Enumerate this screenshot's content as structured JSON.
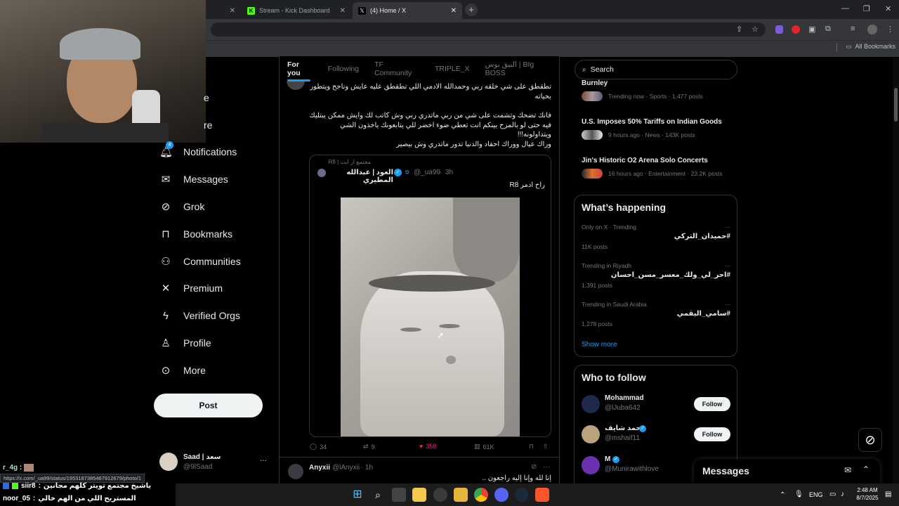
{
  "browser": {
    "tabs": [
      {
        "label": "Stream - Kick Dashboard"
      },
      {
        "label": "(4) Home / X"
      }
    ],
    "bookmarks_label": "All Bookmarks"
  },
  "nav": {
    "items": [
      {
        "label": "Notifications",
        "icon": "bell-icon",
        "badge": "4"
      },
      {
        "label": "Messages",
        "icon": "envelope-icon"
      },
      {
        "label": "Grok",
        "icon": "grok-icon"
      },
      {
        "label": "Bookmarks",
        "icon": "bookmark-icon"
      },
      {
        "label": "Communities",
        "icon": "people-icon"
      },
      {
        "label": "Premium",
        "icon": "x-logo-icon"
      },
      {
        "label": "Verified Orgs",
        "icon": "lightning-icon"
      },
      {
        "label": "Profile",
        "icon": "person-icon"
      },
      {
        "label": "More",
        "icon": "more-circle-icon"
      }
    ],
    "partial_items": [
      "e",
      "re"
    ],
    "post_label": "Post",
    "account": {
      "name": "Saad | سعد",
      "handle": "@9lSaad",
      "more": "···"
    }
  },
  "feed": {
    "tabs": [
      "For you",
      "Following",
      "TF Community",
      "TRIPLE_X",
      "البيق بوس | BIg BOSS"
    ],
    "tweet1": {
      "lines": [
        "تطقطق على شي خلقه ربي وحمدالله الادمي اللي تطقطق عليه عايش وناجح ويتطور",
        "بحياته",
        "فانك تضحك وتشمت على شي من ربي ماتدري ربي وش كاتب لك وايش ممكن يبتليك",
        "فيه حتى لو بالمزح بينكم انت تعطي ضوء اخضر للي يتابعونك ياخذون الشي",
        "ويتداولونه!!!",
        "وراك عيال ووراك احفاد والدنيا تدور ماتدري وش بيصير"
      ]
    },
    "quote": {
      "community": "مجتمع ار ايت | R8",
      "author": "العود | عبدالله المطيري",
      "handle": "@_ua99",
      "time": "3h",
      "text": "راح ادمر R8"
    },
    "actions": {
      "replies": "34",
      "reposts": "9",
      "likes": "358",
      "views": "61K"
    },
    "tweet2": {
      "author": "Anyxii",
      "handle": "@lAnyxii",
      "time": "1h",
      "text": "إنا لله وإنا إليه راجعون .."
    }
  },
  "right": {
    "search_placeholder": "Search",
    "trending_top": [
      {
        "title": "Burnley",
        "meta": "Trending now · Sports · 1,477 posts"
      },
      {
        "title": "U.S. Imposes 50% Tariffs on Indian Goods",
        "meta": "9 hours ago · News · 143K posts"
      },
      {
        "title": "Jin's Historic O2 Arena Solo Concerts",
        "meta": "16 hours ago · Entertainment · 23.2K posts"
      }
    ],
    "happening": {
      "title": "What’s happening",
      "items": [
        {
          "context": "Only on X · Trending",
          "tag": "#حميدان_التركي",
          "posts": "11K posts"
        },
        {
          "context": "Trending in Riyadh",
          "tag": "#احر_لي_ولك_معسر_مسن_احسان",
          "posts": "1,391 posts"
        },
        {
          "context": "Trending in Saudi Arabia",
          "tag": "#سامي_اليقمي",
          "posts": "1,278 posts"
        }
      ],
      "more_dots": "···",
      "show_more": "Show more"
    },
    "who_to_follow": {
      "title": "Who to follow",
      "users": [
        {
          "name": "Mohammad",
          "handle": "@lJuba642",
          "button": "Follow"
        },
        {
          "name": "محمد شايف",
          "handle": "@mshaif11",
          "button": "Follow"
        },
        {
          "name": "M",
          "handle": "@Munirawithlove",
          "button": "Follow"
        }
      ]
    },
    "messages_label": "Messages"
  },
  "overlay": {
    "status_url": "https://x.com/_ua99/status/1953187385467912679/photo/1",
    "chat": [
      {
        "user": "r_4g",
        "text": ""
      },
      {
        "user": "siir8",
        "text": "ياشيخ مجتمع تويتر كلهم مجانين"
      },
      {
        "user": "noor_05",
        "text": "المستريح اللي من الهم خالي"
      }
    ]
  },
  "taskbar": {
    "lang": "ENG",
    "time": "2:48 AM",
    "date": "8/7/2025"
  },
  "colors": {
    "bg": "#000000",
    "text": "#e7e9ea",
    "muted": "#71767b",
    "border": "#2f3336",
    "like": "#f91880",
    "verified": "#1d9bf0"
  }
}
